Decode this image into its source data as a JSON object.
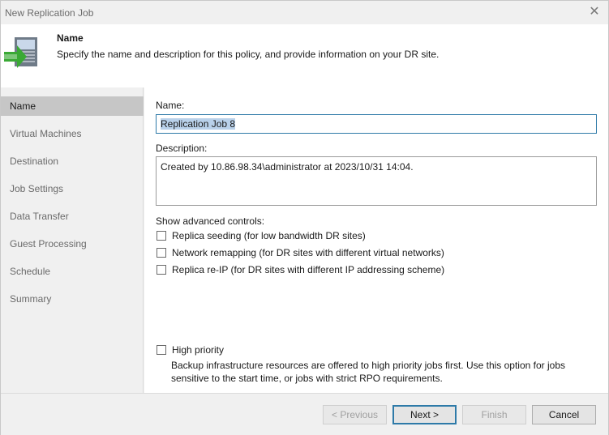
{
  "window": {
    "title": "New Replication Job",
    "close_glyph": "✕"
  },
  "header": {
    "title": "Name",
    "subtitle": "Specify the name and description for this policy, and provide information on your DR site.",
    "icon": "replication-job-icon"
  },
  "sidebar": {
    "items": [
      {
        "label": "Name",
        "active": true
      },
      {
        "label": "Virtual Machines",
        "active": false
      },
      {
        "label": "Destination",
        "active": false
      },
      {
        "label": "Job Settings",
        "active": false
      },
      {
        "label": "Data Transfer",
        "active": false
      },
      {
        "label": "Guest Processing",
        "active": false
      },
      {
        "label": "Schedule",
        "active": false
      },
      {
        "label": "Summary",
        "active": false
      }
    ]
  },
  "form": {
    "name_label": "Name:",
    "name_value": "Replication Job 8",
    "description_label": "Description:",
    "description_value": "Created by 10.86.98.34\\administrator at 2023/10/31 14:04.",
    "advanced_label": "Show advanced controls:",
    "advanced_options": [
      {
        "label": "Replica seeding (for low bandwidth DR sites)",
        "checked": false
      },
      {
        "label": "Network remapping (for DR sites with different virtual networks)",
        "checked": false
      },
      {
        "label": "Replica re-IP (for DR sites with different IP addressing scheme)",
        "checked": false
      }
    ],
    "high_priority": {
      "label": "High priority",
      "checked": false,
      "description": "Backup infrastructure resources are offered to high priority jobs first. Use this option for jobs sensitive to the start time, or jobs with strict RPO requirements."
    }
  },
  "footer": {
    "previous_label": "< Previous",
    "next_label": "Next >",
    "finish_label": "Finish",
    "cancel_label": "Cancel"
  },
  "colors": {
    "accent": "#2e7aa8",
    "icon_green": "#3aa935",
    "selection": "#b9d1ea"
  }
}
